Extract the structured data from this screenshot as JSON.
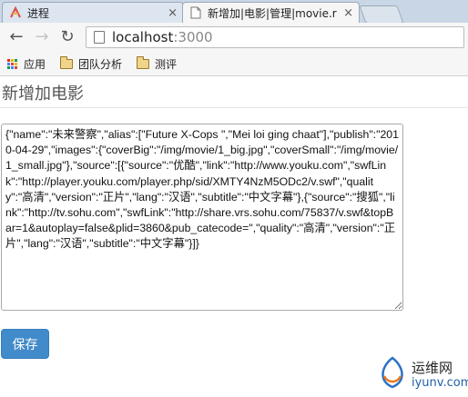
{
  "browser": {
    "tabs": [
      {
        "title": "进程",
        "active": false
      },
      {
        "title": "新增加|电影|管理|movie.r",
        "active": true
      }
    ],
    "close_glyph": "×",
    "back_glyph": "←",
    "forward_glyph": "→",
    "reload_glyph": "↻",
    "url_host": "localhost",
    "url_port": ":3000",
    "bookmarks": [
      {
        "label": "应用",
        "icon": "apps-grid-icon"
      },
      {
        "label": "团队分析",
        "icon": "folder-icon"
      },
      {
        "label": "测评",
        "icon": "folder-icon"
      }
    ],
    "accent_colors": {
      "apps": [
        "#d93025",
        "#f4b400",
        "#0f9d58",
        "#4285f4",
        "#db4437",
        "#f4b400",
        "#0f9d58",
        "#4285f4",
        "#db4437"
      ]
    }
  },
  "page": {
    "title": "新增加电影",
    "json_text": "{\"name\":\"未来警察\",\"alias\":[\"Future X-Cops \",\"Mei loi ging chaat\"],\"publish\":\"2010-04-29\",\"images\":{\"coverBig\":\"/img/movie/1_big.jpg\",\"coverSmall\":\"/img/movie/1_small.jpg\"},\"source\":[{\"source\":\"优酷\",\"link\":\"http://www.youku.com\",\"swfLink\":\"http://player.youku.com/player.php/sid/XMTY4NzM5ODc2/v.swf\",\"quality\":\"高清\",\"version\":\"正片\",\"lang\":\"汉语\",\"subtitle\":\"中文字幕\"},{\"source\":\"搜狐\",\"link\":\"http://tv.sohu.com\",\"swfLink\":\"http://share.vrs.sohu.com/75837/v.swf&topBar=1&autoplay=false&plid=3860&pub_catecode=\",\"quality\":\"高清\",\"version\":\"正片\",\"lang\":\"汉语\",\"subtitle\":\"中文字幕\"}]}",
    "save_label": "保存",
    "primary_color": "#428bca"
  },
  "watermark": {
    "cn": "运维网",
    "en": "iyunv.com"
  }
}
